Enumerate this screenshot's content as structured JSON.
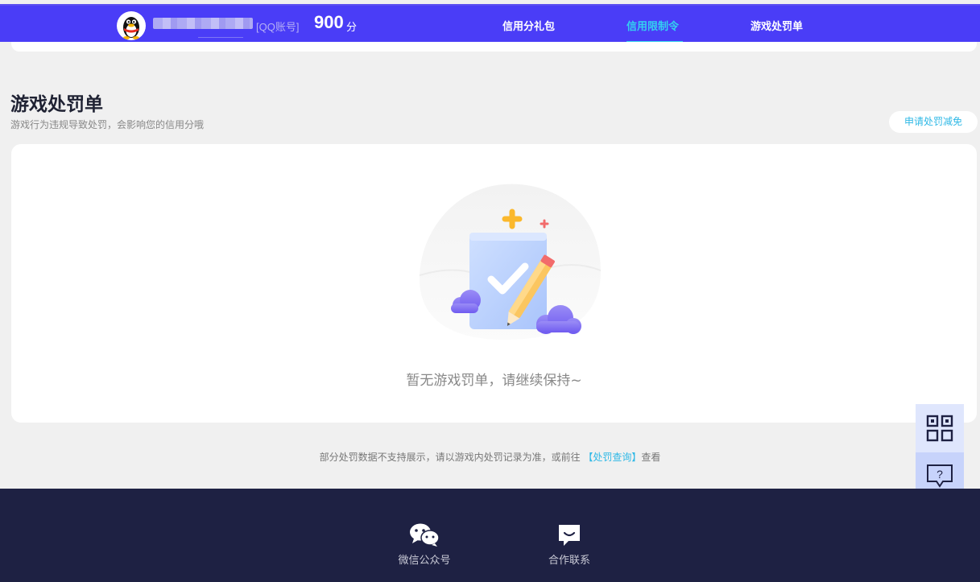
{
  "header": {
    "account_tag": "[QQ账号]",
    "score": "900",
    "score_unit": "分",
    "nav": [
      {
        "label": "信用分礼包",
        "active": false
      },
      {
        "label": "信用限制令",
        "active": true
      },
      {
        "label": "游戏处罚单",
        "active": false
      }
    ],
    "accent_color": "#4a3df7",
    "active_color": "#33d0f0"
  },
  "section": {
    "title": "游戏处罚单",
    "subtitle": "游戏行为违规导致处罚，会影响您的信用分哦",
    "appeal_button": "申请处罚减免"
  },
  "empty_state": {
    "message": "暂无游戏罚单，请继续保持~",
    "icon": "empty-checklist-illustration"
  },
  "note": {
    "prefix": "部分处罚数据不支持展示，请以游戏内处罚记录为准，或前往",
    "link": "【处罚查询】",
    "suffix": "查看"
  },
  "side_tools": {
    "qr_icon": "qr-code-icon",
    "help_icon": "help-chat-icon"
  },
  "footer": {
    "items": [
      {
        "label": "微信公众号",
        "icon": "wechat-icon"
      },
      {
        "label": "合作联系",
        "icon": "chat-bubble-icon"
      }
    ]
  }
}
